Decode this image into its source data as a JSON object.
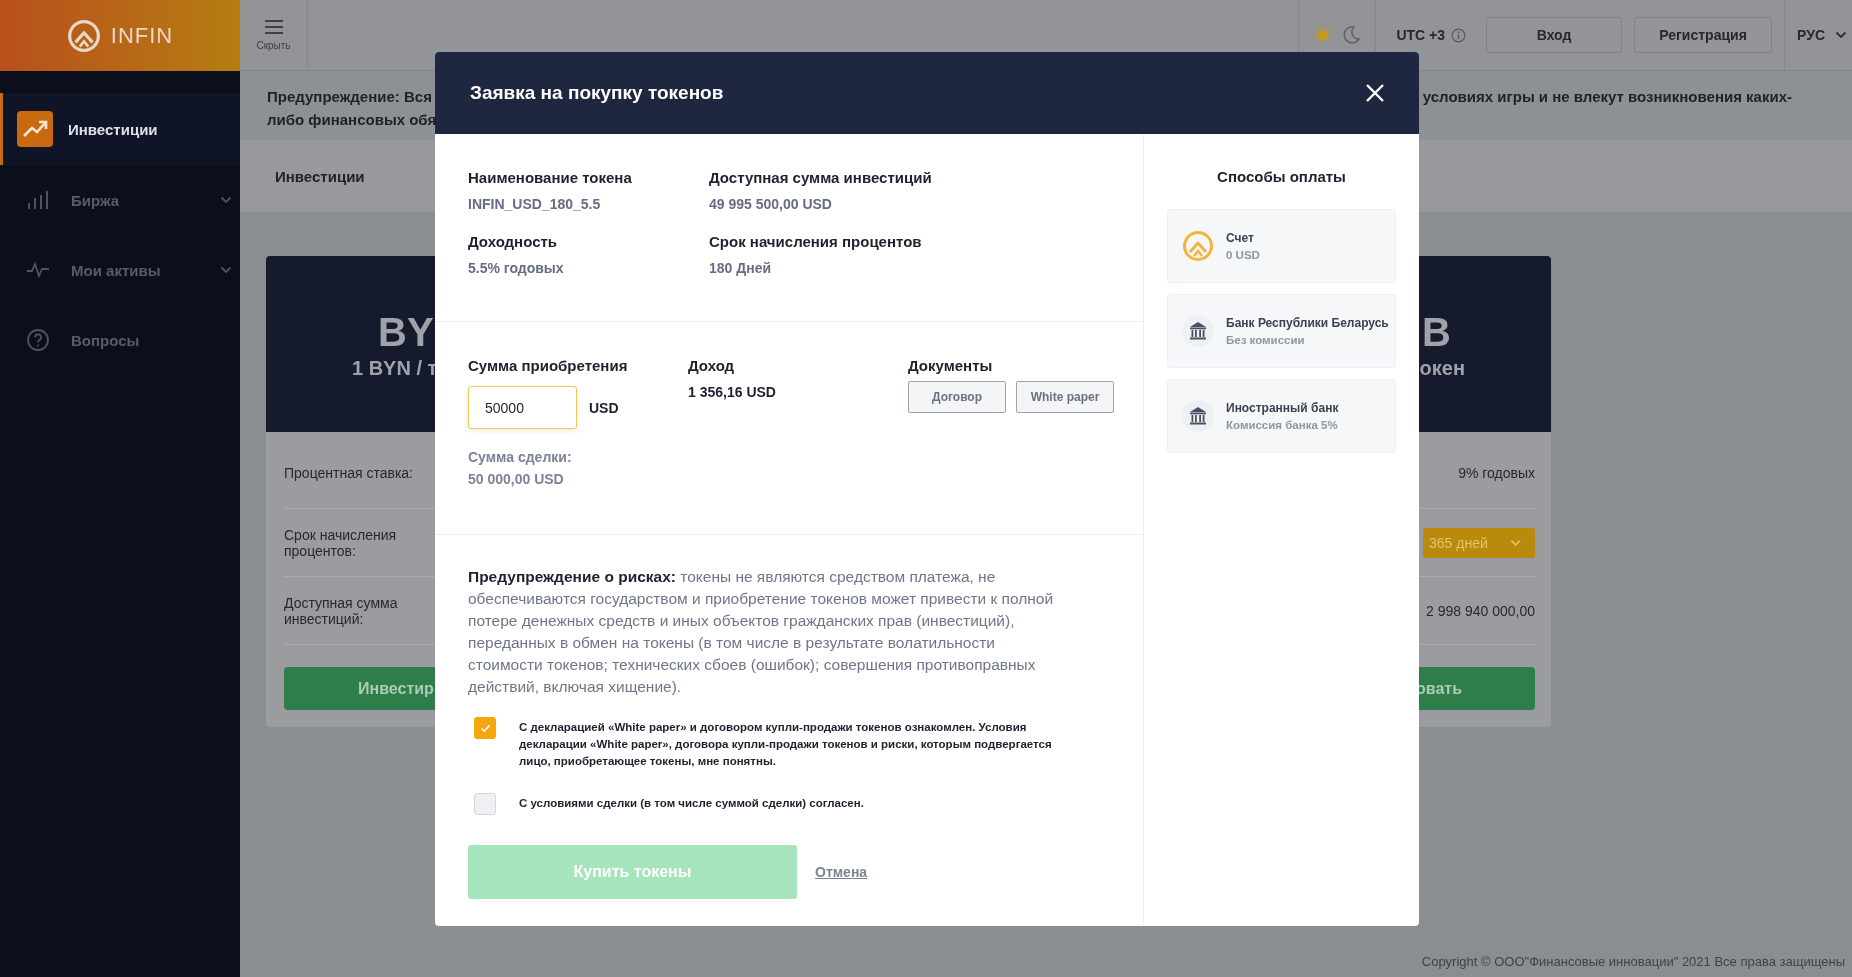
{
  "sidebar": {
    "logo": "INFIN",
    "items": [
      {
        "label": "Инвестиции",
        "selected": true,
        "kind": "link"
      },
      {
        "label": "Биржа",
        "selected": false,
        "kind": "group"
      },
      {
        "label": "Мои активы",
        "selected": false,
        "kind": "group"
      },
      {
        "label": "Вопросы",
        "selected": false,
        "kind": "link"
      }
    ]
  },
  "topbar": {
    "menu_label": "Скрыть",
    "dark_mode": false,
    "timezone": "UTC +3",
    "login": "Вход",
    "register": "Регистрация",
    "language": "РУС"
  },
  "warning": {
    "left_lines": [
      "Предупреждение: Вся",
      "либо финансовых обя"
    ],
    "right_lines": [
      "условиях игры и не влекут возникновения каких-"
    ]
  },
  "breadcrumb": "Инвестиции",
  "cards": [
    {
      "currency": "BY",
      "rate": "1 BYN / т",
      "rows": [
        {
          "label": "Процентная ставка:"
        },
        {
          "label": "Срок начисления процентов:"
        },
        {
          "label": "Доступная сумма инвестиций:"
        }
      ],
      "button": "Инвестир"
    },
    {
      "currency": "B",
      "rate": "окен",
      "rows": [
        {
          "value": "9% годовых",
          "kind": "text"
        },
        {
          "value": "365 дней",
          "kind": "dropdown"
        },
        {
          "value": "2 998 940 000,00",
          "kind": "text"
        }
      ],
      "button": "овать"
    }
  ],
  "modal": {
    "title": "Заявка на покупку токенов",
    "info": [
      {
        "label": "Наименование токена",
        "value": "INFIN_USD_180_5.5"
      },
      {
        "label": "Доступная сумма инвестиций",
        "value": "49 995 500,00 USD"
      },
      {
        "label": "Доходность",
        "value": "5.5% годовых"
      },
      {
        "label": "Срок начисления процентов",
        "value": "180 Дней"
      }
    ],
    "purchase": {
      "label": "Сумма приобретения",
      "amount": "50000",
      "currency": "USD",
      "total_label": "Сумма сделки:",
      "total": "50 000,00 USD"
    },
    "income": {
      "label": "Доход",
      "value": "1 356,16 USD"
    },
    "documents": {
      "label": "Документы",
      "buttons": [
        "Договор",
        "White paper"
      ]
    },
    "risk": "**Предупреждение о рисках:** токены не являются средством платежа, не обеспечиваются государством и приобретение токенов может привести к полной потере денежных средств и иных объектов гражданских прав (инвестиций), переданных в обмен на токены (в том числе в результате волатильности стоимости токенов; технических сбоев (ошибок); совершения противоправных действий, включая хищение).",
    "consents": [
      {
        "text": "С декларацией «White paper» и договором купли-продажи токенов ознакомлен. Условия декларации «White paper», договора купли-продажи токенов и риски, которым подвергается лицо, приобретающее токены, мне понятны.",
        "checked": true
      },
      {
        "text": "С условиями сделки (в том числе суммой сделки) согласен.",
        "checked": false
      }
    ],
    "buy_button": {
      "label": "Купить токены",
      "disabled": true
    },
    "cancel": "Отмена",
    "payment": {
      "title": "Способы оплаты",
      "methods": [
        {
          "kind": "account",
          "name": "Счет",
          "note": "0 USD"
        },
        {
          "kind": "bank",
          "name": "Банк Республики Беларусь",
          "note": "Без комиссии"
        },
        {
          "kind": "bank",
          "name": "Иностранный банк",
          "note": "Комиссия банка 5%"
        }
      ]
    }
  },
  "footer": "Copyright © ООО\"Финансовые инновации\" 2021 Все права защищены"
}
